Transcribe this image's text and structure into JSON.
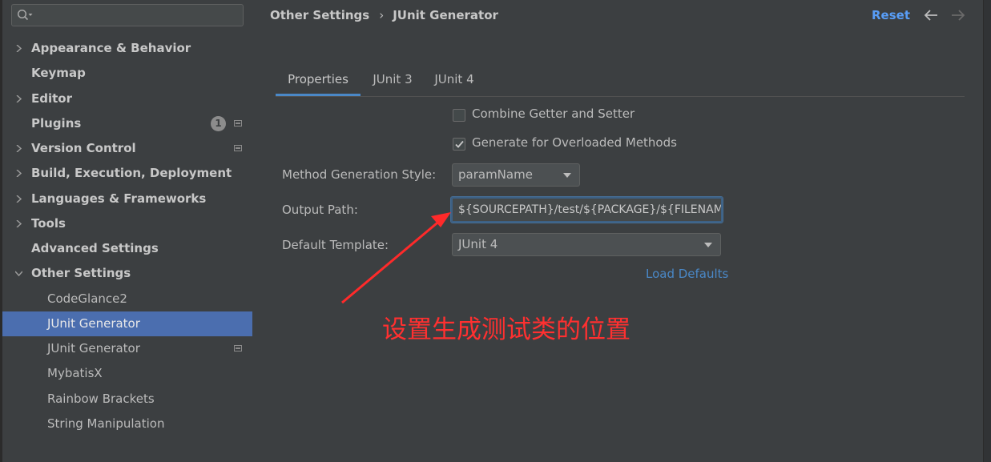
{
  "search": {
    "placeholder": ""
  },
  "sidebar": {
    "items": [
      {
        "label": "Appearance & Behavior",
        "expandable": true
      },
      {
        "label": "Keymap"
      },
      {
        "label": "Editor",
        "expandable": true
      },
      {
        "label": "Plugins",
        "badge": "1"
      },
      {
        "label": "Version Control",
        "expandable": true
      },
      {
        "label": "Build, Execution, Deployment",
        "expandable": true
      },
      {
        "label": "Languages & Frameworks",
        "expandable": true
      },
      {
        "label": "Tools",
        "expandable": true
      },
      {
        "label": "Advanced Settings"
      },
      {
        "label": "Other Settings",
        "expanded": true
      },
      {
        "label": "CodeGlance2"
      },
      {
        "label": "JUnit Generator",
        "selected": true
      },
      {
        "label": "JUnit Generator"
      },
      {
        "label": "MybatisX"
      },
      {
        "label": "Rainbow Brackets"
      },
      {
        "label": "String Manipulation"
      }
    ]
  },
  "header": {
    "breadcrumb_parent": "Other Settings",
    "breadcrumb_separator": "›",
    "breadcrumb_current": "JUnit Generator",
    "reset_label": "Reset"
  },
  "tabs": [
    {
      "label": "Properties",
      "active": true
    },
    {
      "label": "JUnit 3"
    },
    {
      "label": "JUnit 4"
    }
  ],
  "form": {
    "combine_getter_setter": {
      "label": "Combine Getter and Setter",
      "checked": false
    },
    "generate_overloaded": {
      "label": "Generate for Overloaded Methods",
      "checked": true
    },
    "method_generation_style": {
      "label": "Method Generation Style:",
      "value": "paramName"
    },
    "output_path": {
      "label": "Output Path:",
      "value": "${SOURCEPATH}/test/${PACKAGE}/${FILENAME}"
    },
    "default_template": {
      "label": "Default Template:",
      "value": "JUnit 4"
    },
    "load_defaults_label": "Load Defaults"
  },
  "annotation": {
    "text": "设置生成测试类的位置",
    "color": "#ff3030"
  },
  "colors": {
    "accent": "#4a88c7",
    "selection": "#4b6eaf",
    "reset": "#589df6"
  }
}
